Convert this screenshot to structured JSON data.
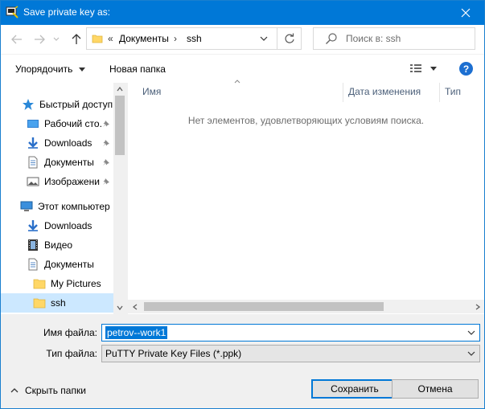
{
  "window": {
    "title": "Save private key as:",
    "accent_color": "#0078d7"
  },
  "nav": {
    "back_icon": "arrow-left-icon",
    "forward_icon": "arrow-right-icon",
    "recent_icon": "chevron-down-icon",
    "up_icon": "arrow-up-icon",
    "address": {
      "overflow": "«",
      "segments": [
        "Документы",
        "ssh"
      ],
      "separator": "›"
    },
    "search_placeholder": "Поиск в: ssh"
  },
  "toolbar": {
    "organize_label": "Упорядочить",
    "new_folder_label": "Новая папка"
  },
  "sidebar": {
    "items": [
      {
        "label": "Быстрый доступ",
        "icon": "star-icon"
      },
      {
        "label": "Рабочий сто.",
        "icon": "desktop-icon",
        "pinned": true
      },
      {
        "label": "Downloads",
        "icon": "download-icon",
        "pinned": true
      },
      {
        "label": "Документы",
        "icon": "document-icon",
        "pinned": true
      },
      {
        "label": "Изображени",
        "icon": "image-icon",
        "pinned": true
      },
      {
        "label": "Этот компьютер",
        "icon": "computer-icon"
      },
      {
        "label": "Downloads",
        "icon": "download-icon"
      },
      {
        "label": "Видео",
        "icon": "video-icon"
      },
      {
        "label": "Документы",
        "icon": "document-icon"
      },
      {
        "label": "My Pictures",
        "icon": "folder-icon"
      },
      {
        "label": "ssh",
        "icon": "folder-icon",
        "selected": true
      }
    ]
  },
  "files": {
    "columns": [
      "Имя",
      "Дата изменения",
      "Тип"
    ],
    "empty_message": "Нет элементов, удовлетворяющих условиям поиска."
  },
  "form": {
    "filename_label": "Имя файла:",
    "filename_value": "petrov--work1",
    "filetype_label": "Тип файла:",
    "filetype_value": "PuTTY Private Key Files (*.ppk)"
  },
  "footer": {
    "hide_folders_label": "Скрыть папки",
    "save_label": "Сохранить",
    "cancel_label": "Отмена"
  }
}
